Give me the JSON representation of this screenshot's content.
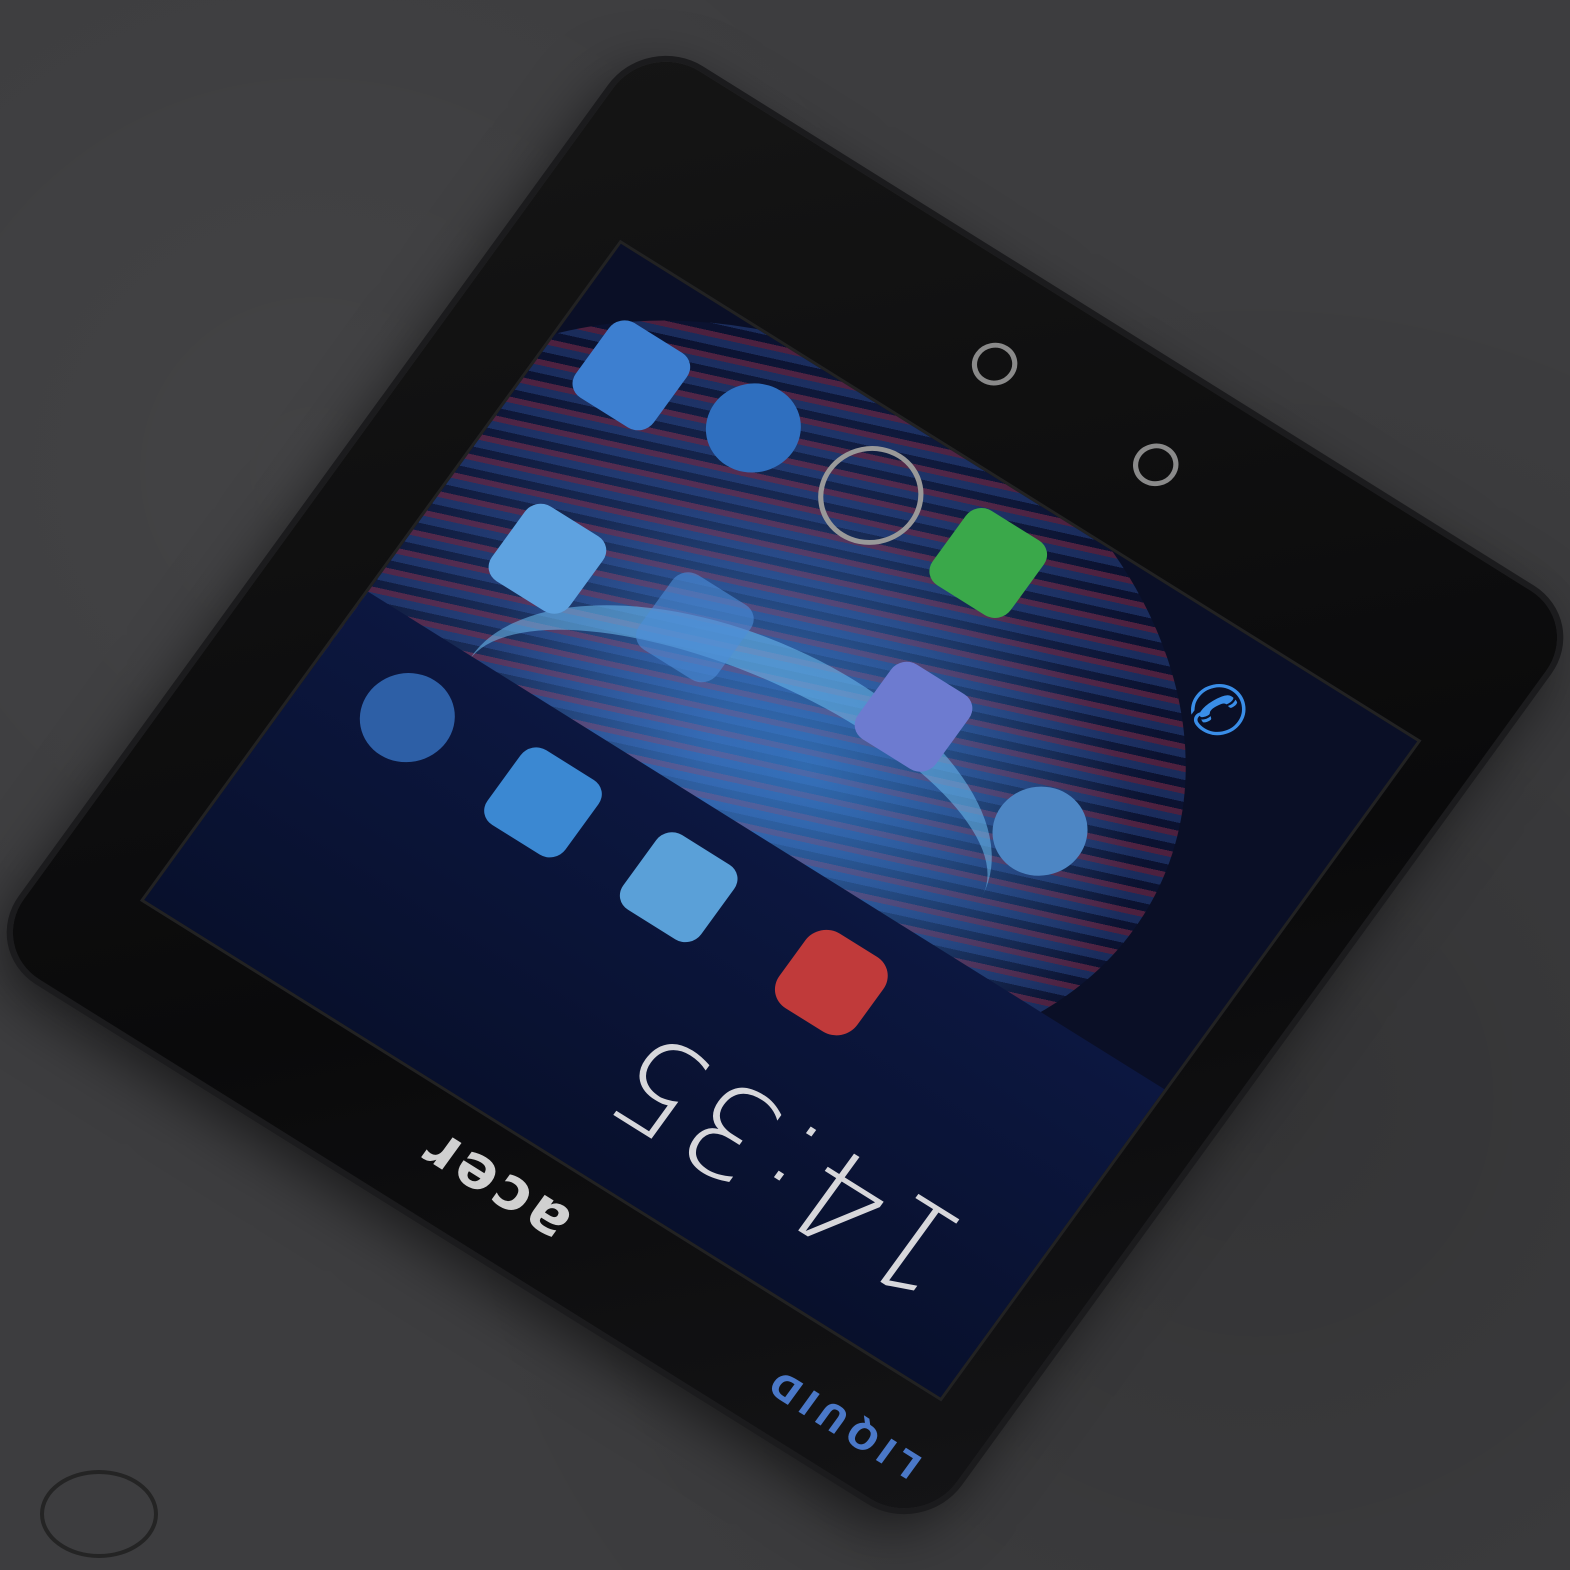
{
  "clock": {
    "time": "14:35"
  },
  "brand": {
    "name": "acer"
  },
  "model": {
    "label": "LIQUID"
  },
  "icons": {
    "phone": "phone-icon",
    "apps": [
      "contacts-icon",
      "globe-icon",
      "settings-icon",
      "messages-icon",
      "gallery-icon",
      "market-icon",
      "browser-icon",
      "camera-icon",
      "email-icon",
      "calendar-icon",
      "weather-icon",
      "music-icon"
    ]
  },
  "colors": {
    "background": "#3d3d3f",
    "phone_body": "#0c0c0d",
    "screen_accent": "#3a8ee8",
    "clock_text": "#d7d7db"
  }
}
